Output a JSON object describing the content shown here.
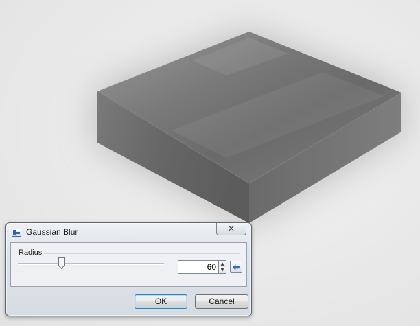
{
  "dialog": {
    "title": "Gaussian Blur",
    "close_glyph": "✕",
    "group_label": "Radius",
    "radius": {
      "value": "60",
      "slider_fraction": 0.3
    },
    "spin_up_glyph": "▲",
    "spin_down_glyph": "▼",
    "ok_label": "OK",
    "cancel_label": "Cancel"
  },
  "icons": {
    "app": "window-app-icon",
    "close": "close-icon",
    "reset": "reset-arrow-icon"
  },
  "colors": {
    "ok_focus_border": "#3c7fb1",
    "reset_arrow": "#2b74c7"
  }
}
